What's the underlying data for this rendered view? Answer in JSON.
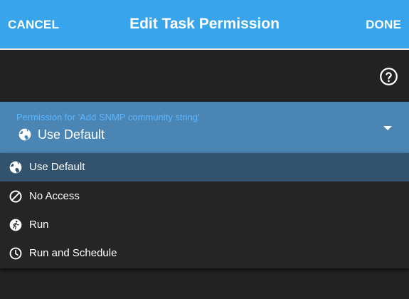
{
  "header": {
    "cancel_label": "CANCEL",
    "title": "Edit Task Permission",
    "done_label": "DONE"
  },
  "field": {
    "label": "Permission for 'Add SNMP community string'",
    "value": "Use Default",
    "icon": "globe-icon"
  },
  "menu": {
    "items": [
      {
        "label": "Use Default",
        "icon": "globe-icon",
        "selected": true
      },
      {
        "label": "No Access",
        "icon": "block-icon",
        "selected": false
      },
      {
        "label": "Run",
        "icon": "run-icon",
        "selected": false
      },
      {
        "label": "Run and Schedule",
        "icon": "clock-icon",
        "selected": false
      }
    ]
  },
  "colors": {
    "header_bg": "#38a4ec",
    "field_bg": "#4a85b4",
    "field_label": "#5cb7ff",
    "selected_bg": "#33526d",
    "page_bg": "#222222"
  }
}
